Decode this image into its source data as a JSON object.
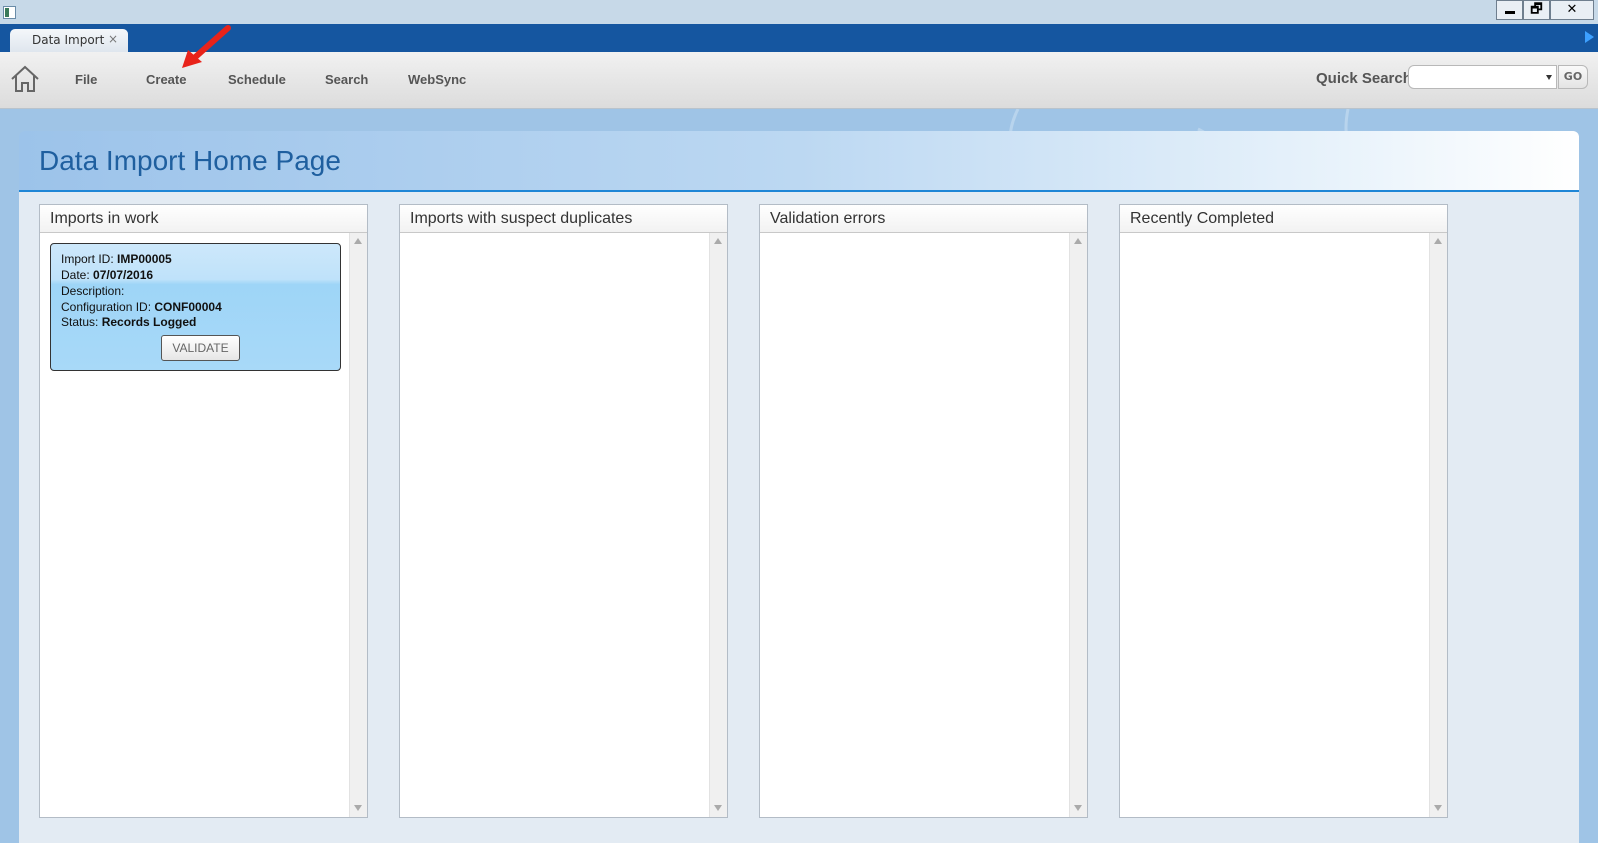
{
  "window": {
    "minimize_label": "",
    "restore_label": "🗗",
    "close_label": "✕"
  },
  "tabs": [
    {
      "label": "Data Import",
      "close": "×"
    }
  ],
  "menu": {
    "items": [
      "File",
      "Create",
      "Schedule",
      "Search",
      "WebSync"
    ]
  },
  "quick_search": {
    "label": "Quick Search",
    "value": "",
    "go_label": "GO"
  },
  "page": {
    "title": "Data Import Home Page"
  },
  "panels": [
    {
      "title": "Imports in work"
    },
    {
      "title": "Imports with suspect duplicates"
    },
    {
      "title": "Validation errors"
    },
    {
      "title": "Recently Completed"
    }
  ],
  "import_card": {
    "import_id_label": "Import ID: ",
    "import_id": "IMP00005",
    "date_label": "Date: ",
    "date": "07/07/2016",
    "description_label": "Description:",
    "description": "",
    "config_label": "Configuration ID: ",
    "config_id": "CONF00004",
    "status_label": "Status: ",
    "status": "Records Logged",
    "validate_label": "VALIDATE"
  },
  "colors": {
    "tab_strip": "#1556a0",
    "title_accent": "#1f5f9f",
    "header_underline": "#1f86d6",
    "card_blue": "#a8d9f8",
    "annotation_arrow": "#e8231a"
  }
}
